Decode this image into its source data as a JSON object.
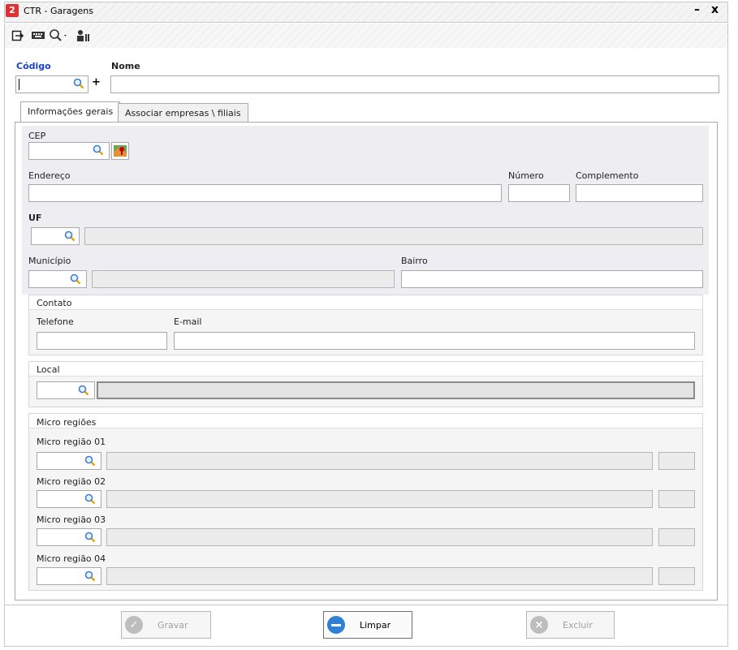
{
  "window": {
    "title": "CTR - Garagens",
    "minimize": "–",
    "close": "x"
  },
  "toolbar": {
    "icons": [
      "exit-icon",
      "keyboard-icon",
      "search-dropdown-icon",
      "users-icon"
    ]
  },
  "header": {
    "codigo_label": "Código",
    "nome_label": "Nome",
    "codigo_value": "",
    "nome_value": "",
    "add_symbol": "+"
  },
  "tabs": [
    {
      "label": "Informações gerais",
      "active": true
    },
    {
      "label": "Associar empresas \\ filiais",
      "active": false
    }
  ],
  "form": {
    "cep_label": "CEP",
    "endereco_label": "Endereço",
    "numero_label": "Número",
    "complemento_label": "Complemento",
    "uf_label": "UF",
    "municipio_label": "Município",
    "bairro_label": "Bairro"
  },
  "contato": {
    "title": "Contato",
    "telefone_label": "Telefone",
    "email_label": "E-mail"
  },
  "local": {
    "title": "Local"
  },
  "micro_regioes": {
    "title": "Micro regiões",
    "items": [
      {
        "label": "Micro região 01"
      },
      {
        "label": "Micro região 02"
      },
      {
        "label": "Micro região 03"
      },
      {
        "label": "Micro região 04"
      }
    ]
  },
  "footer": {
    "gravar": "Gravar",
    "limpar": "Limpar",
    "excluir": "Excluir"
  },
  "colors": {
    "accent_label": "#1a3fcf",
    "limpar_icon": "#2f7fd6",
    "disabled_icon": "#bdbdbd",
    "app_icon": "#e03030"
  }
}
